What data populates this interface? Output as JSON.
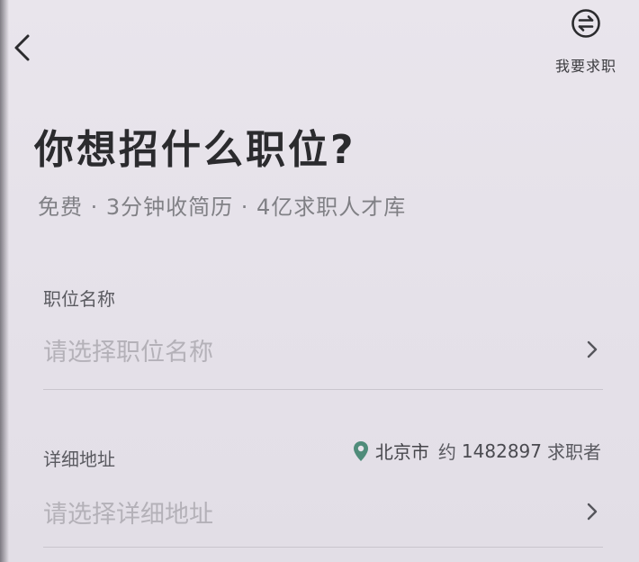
{
  "header": {
    "switch_role_label": "我要求职",
    "back_icon": "chevron-left-icon",
    "switch_icon": "swap-circle-icon"
  },
  "title": "你想招什么职位?",
  "subtitle": "免费 · 3分钟收简历 · 4亿求职人才库",
  "fields": {
    "position": {
      "label": "职位名称",
      "placeholder": "请选择职位名称"
    },
    "address": {
      "label": "详细地址",
      "placeholder": "请选择详细地址",
      "city": "北京市",
      "approx": "约",
      "seeker_count": "1482897",
      "seeker_suffix": "求职者"
    }
  },
  "colors": {
    "background": "#e7e3ea",
    "title": "#2b2b2e",
    "subtitle": "#808085",
    "placeholder": "#b4b1b8",
    "pin": "#4f8c7a"
  }
}
